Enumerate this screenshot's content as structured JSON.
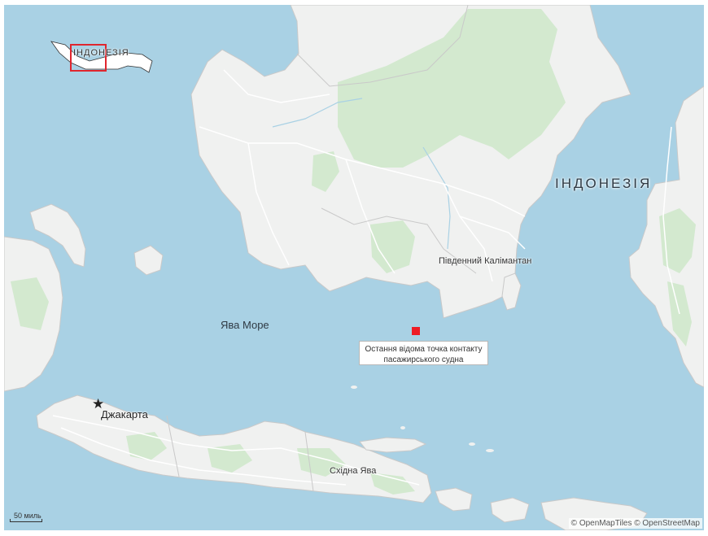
{
  "map": {
    "country_label": "ІНДОНЕЗІЯ",
    "sea_label": "Ява Море",
    "region_labels": {
      "south_kalimantan": "Південний Калімантан",
      "east_java": "Східна Ява"
    },
    "capital_label": "Джакарта",
    "marker_caption": {
      "line1": "Остання відома точка контакту",
      "line2": "пасажирського судна"
    },
    "scale_label": "50 миль",
    "attribution": "© OpenMapTiles © OpenStreetMap",
    "inset": {
      "country_label": "ІНДОНЕЗІЯ"
    },
    "colors": {
      "water": "#a9d1e4",
      "land": "#f0f1f0",
      "forest": "#d3e9cf",
      "roads": "#ffffff",
      "borders": "#c9c9c9",
      "marker": "#ee1c25"
    }
  }
}
